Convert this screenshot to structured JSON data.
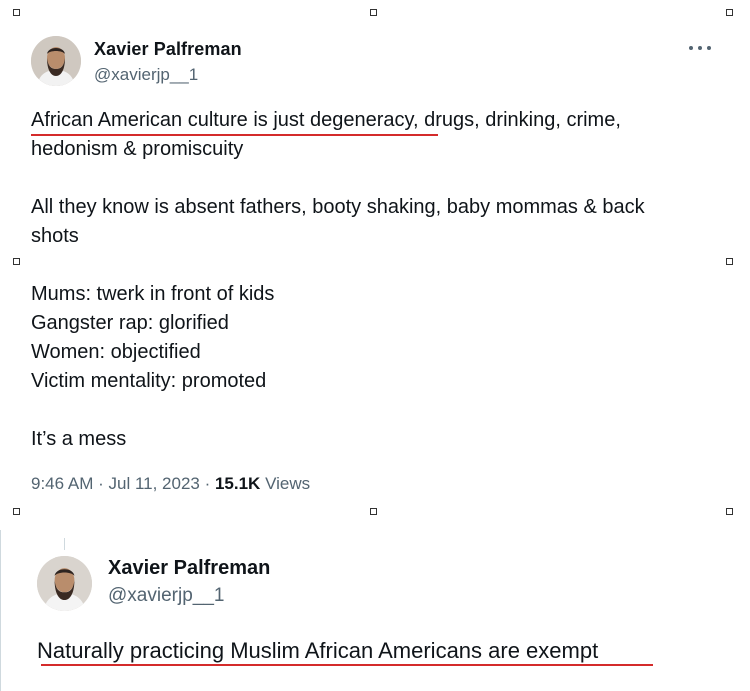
{
  "tweet1": {
    "author_name": "Xavier Palfreman",
    "author_handle": "@xavierjp__1",
    "avatar_icon": "profile-photo-icon",
    "more_icon": "more-options-icon",
    "lines": {
      "l1a": "African American culture is just degeneracy",
      "l1b": ", drugs, drinking, crime,",
      "l2": "hedonism & promiscuity",
      "l3": "All they know is absent fathers, booty shaking, baby mommas & back",
      "l4": "shots",
      "l5": "Mums: twerk in front of kids",
      "l6": "Gangster rap: glorified",
      "l7": "Women: objectified",
      "l8": "Victim mentality: promoted",
      "l9": "It’s a mess"
    },
    "meta": {
      "time": "9:46 AM",
      "sep1": " · ",
      "date": "Jul 11, 2023",
      "sep2": " · ",
      "views_count": "15.1K",
      "views_label": " Views"
    }
  },
  "tweet2": {
    "author_name": "Xavier Palfreman",
    "author_handle": "@xavierjp__1",
    "avatar_icon": "profile-photo-icon",
    "text": "Naturally practicing Muslim African Americans are exempt"
  },
  "colors": {
    "underline": "#d42b2b",
    "secondary_text": "#536471",
    "primary_text": "#0f1419"
  }
}
